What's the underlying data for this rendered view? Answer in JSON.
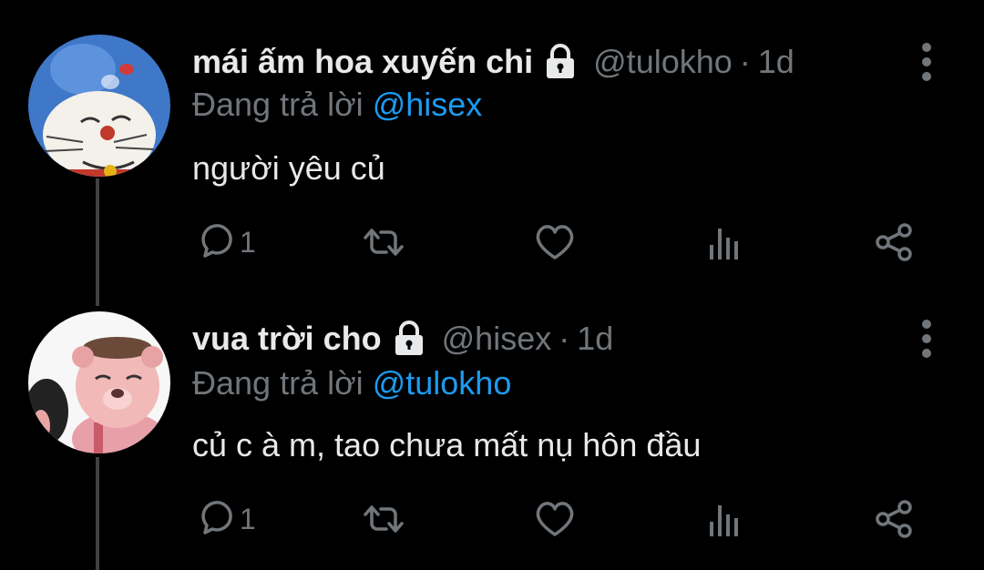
{
  "tweets": [
    {
      "display_name": "mái ấm hoa xuyến chi",
      "handle": "@tulokho",
      "separator": "·",
      "time": "1d",
      "reply_prefix": "Đang trả lời",
      "reply_to": "@hisex",
      "text": "người yêu củ",
      "reply_count": "1",
      "avatar_icon": "doraemon-avatar",
      "protected_icon": "lock-icon"
    },
    {
      "display_name": "vua trời cho",
      "handle": "@hisex",
      "separator": "·",
      "time": "1d",
      "reply_prefix": "Đang trả lời",
      "reply_to": "@tulokho",
      "text": "củ c à m, tao chưa mất nụ hôn đầu",
      "reply_count": "1",
      "avatar_icon": "cartoon-bear-avatar",
      "protected_icon": "lock-icon"
    }
  ],
  "colors": {
    "background": "#000000",
    "primary_text": "#e7e9ea",
    "secondary_text": "#71767b",
    "mention": "#1d9bf0",
    "thread_line": "#3e4144"
  },
  "icons": [
    "reply-icon",
    "retweet-icon",
    "like-icon",
    "views-icon",
    "share-icon",
    "more-options-icon"
  ]
}
